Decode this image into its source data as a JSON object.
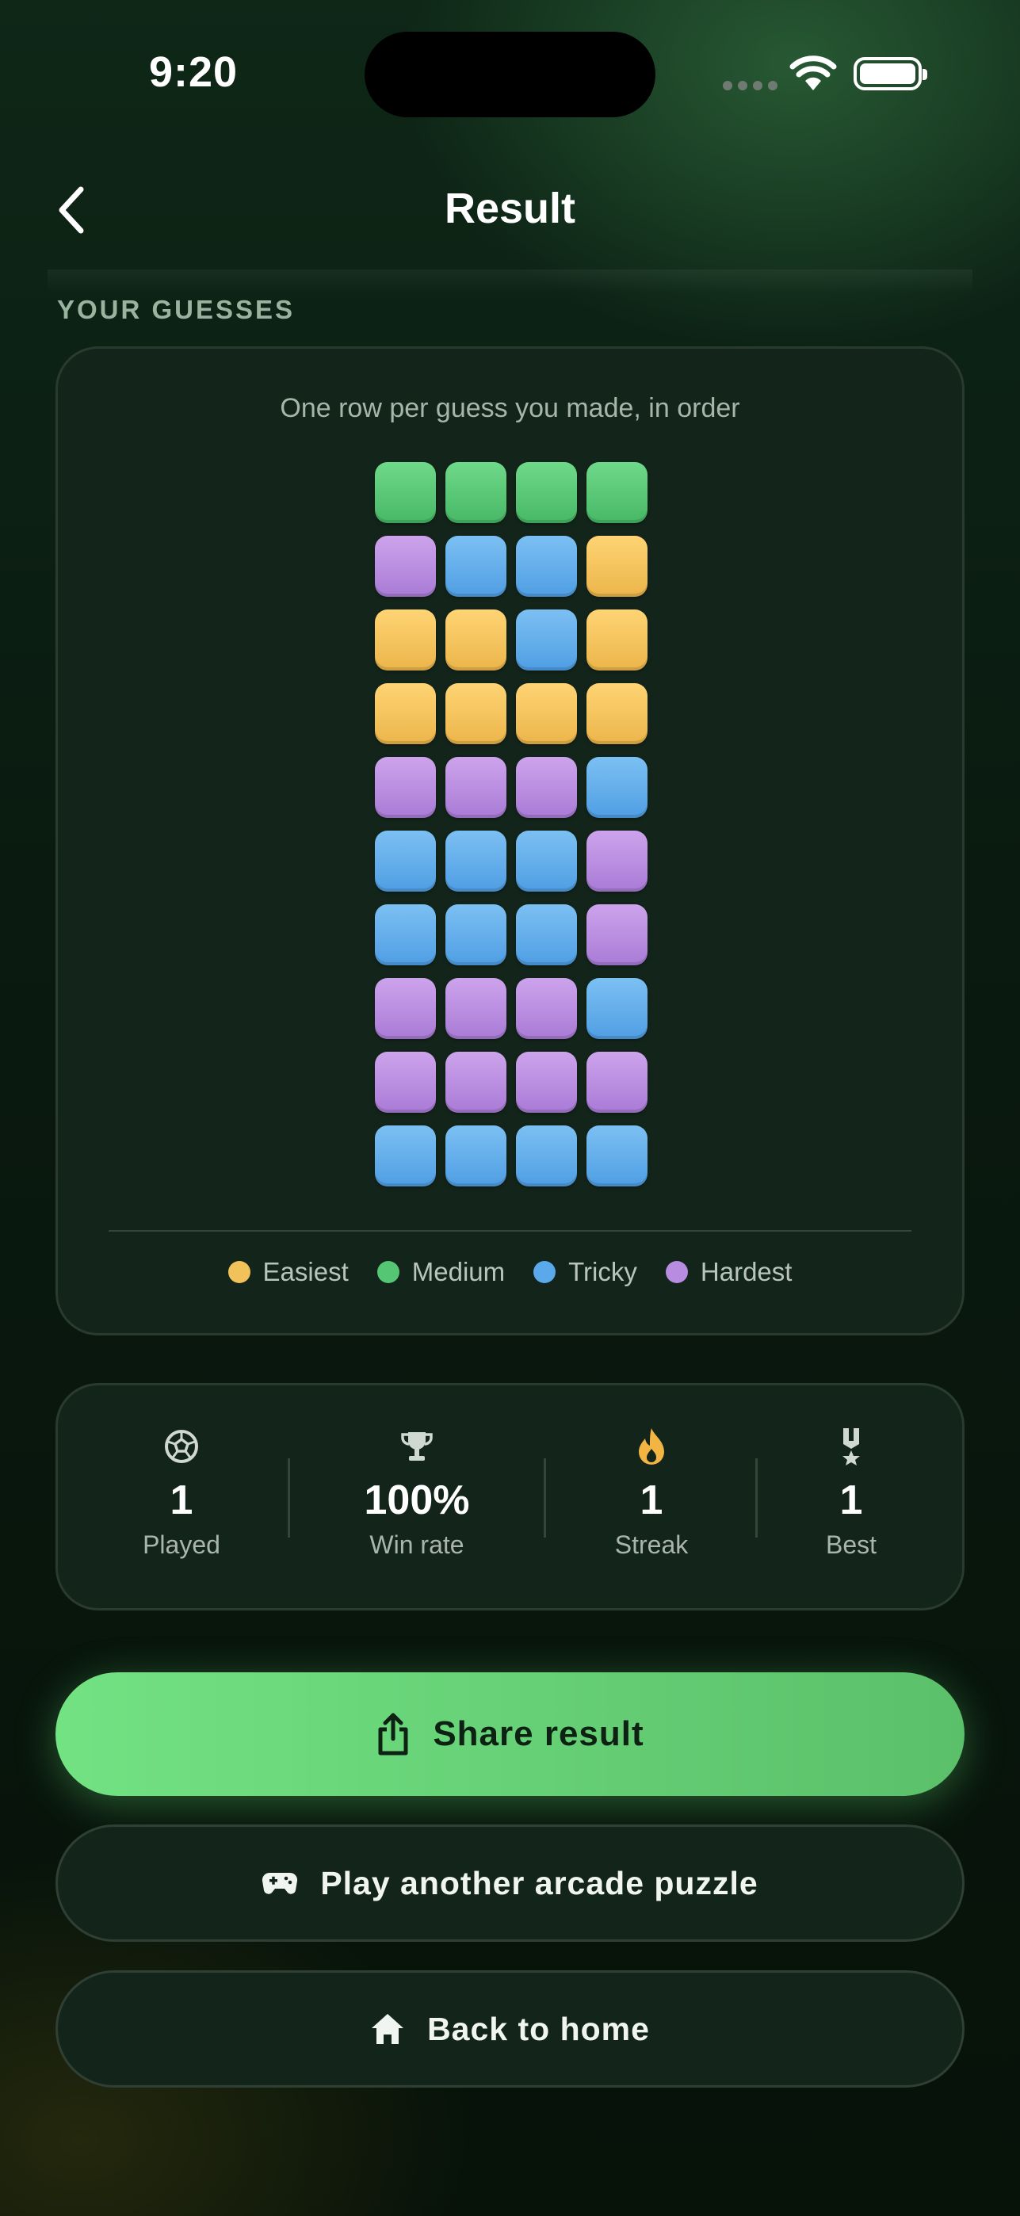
{
  "status": {
    "time": "9:20"
  },
  "header": {
    "title": "Result"
  },
  "guesses": {
    "section_label": "YOUR GUESSES",
    "caption": "One row per guess you made, in order",
    "rows": [
      [
        "medium",
        "medium",
        "medium",
        "medium"
      ],
      [
        "hardest",
        "tricky",
        "tricky",
        "easiest"
      ],
      [
        "easiest",
        "easiest",
        "tricky",
        "easiest"
      ],
      [
        "easiest",
        "easiest",
        "easiest",
        "easiest"
      ],
      [
        "hardest",
        "hardest",
        "hardest",
        "tricky"
      ],
      [
        "tricky",
        "tricky",
        "tricky",
        "hardest"
      ],
      [
        "tricky",
        "tricky",
        "tricky",
        "hardest"
      ],
      [
        "hardest",
        "hardest",
        "hardest",
        "tricky"
      ],
      [
        "hardest",
        "hardest",
        "hardest",
        "hardest"
      ],
      [
        "tricky",
        "tricky",
        "tricky",
        "tricky"
      ]
    ],
    "legend": [
      {
        "key": "easiest",
        "label": "Easiest",
        "color": "#f2c25a"
      },
      {
        "key": "medium",
        "label": "Medium",
        "color": "#55c673"
      },
      {
        "key": "tricky",
        "label": "Tricky",
        "color": "#5aa9ea"
      },
      {
        "key": "hardest",
        "label": "Hardest",
        "color": "#b88ce0"
      }
    ]
  },
  "stats": {
    "played": {
      "value": "1",
      "label": "Played",
      "icon": "soccer-ball-icon"
    },
    "win_rate": {
      "value": "100%",
      "label": "Win rate",
      "icon": "trophy-icon"
    },
    "streak": {
      "value": "1",
      "label": "Streak",
      "icon": "flame-icon"
    },
    "best": {
      "value": "1",
      "label": "Best",
      "icon": "medal-icon"
    }
  },
  "actions": {
    "share": {
      "label": "Share result",
      "icon": "share-icon"
    },
    "play_another": {
      "label": "Play another arcade puzzle",
      "icon": "gamepad-icon"
    },
    "home": {
      "label": "Back to home",
      "icon": "home-icon"
    }
  },
  "colors": {
    "accent": "#6ad77e",
    "background": "#0b1c11",
    "card": "#13251a"
  }
}
